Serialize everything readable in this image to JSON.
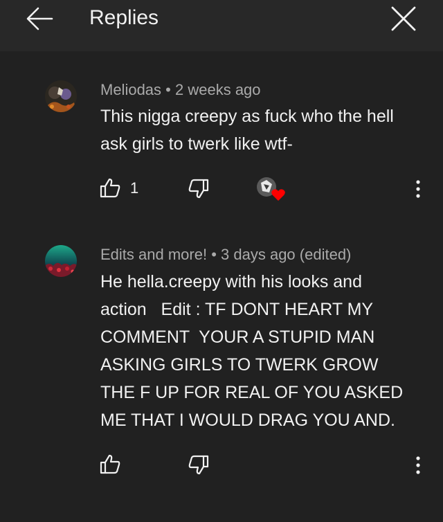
{
  "header": {
    "title": "Replies",
    "back_icon": "arrow-left-icon",
    "close_icon": "close-icon"
  },
  "comments": [
    {
      "author": "Meliodas",
      "separator": "•",
      "time": "2 weeks ago",
      "text": "This nigga creepy as fuck who the hell ask girls to twerk like wtf-",
      "likes": "1",
      "creator_heart": true
    },
    {
      "author": "Edits and more!",
      "separator": "•",
      "time": "3 days ago (edited)",
      "text": "He hella.creepy with his looks and action   Edit : TF DONT HEART MY COMMENT  YOUR A STUPID MAN ASKING GIRLS TO TWERK GROW THE F UP FOR REAL OF YOU ASKED ME THAT I WOULD DRAG YOU AND.",
      "likes": "",
      "creator_heart": false
    }
  ],
  "colors": {
    "background": "#212121",
    "header": "#282828",
    "text": "#f1f1f1",
    "meta": "#aaaaaa",
    "heart": "#ff0000"
  }
}
